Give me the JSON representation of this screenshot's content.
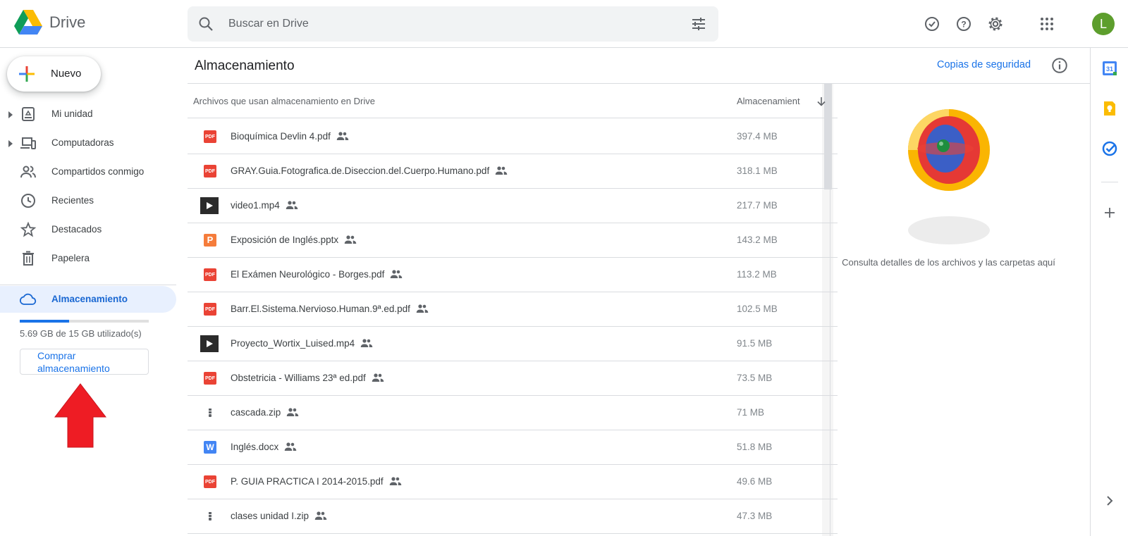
{
  "header": {
    "app_name": "Drive",
    "search_placeholder": "Buscar en Drive",
    "avatar_letter": "L",
    "icons": [
      "ready-offline-icon",
      "help-icon",
      "settings-icon",
      "apps-icon"
    ]
  },
  "sidebar": {
    "new_label": "Nuevo",
    "items": [
      {
        "label": "Mi unidad",
        "icon": "my-drive-icon"
      },
      {
        "label": "Computadoras",
        "icon": "computers-icon"
      },
      {
        "label": "Compartidos conmigo",
        "icon": "shared-icon"
      },
      {
        "label": "Recientes",
        "icon": "clock-icon"
      },
      {
        "label": "Destacados",
        "icon": "star-icon"
      },
      {
        "label": "Papelera",
        "icon": "trash-icon"
      }
    ],
    "storage": {
      "label": "Almacenamiento",
      "used_text": "5.69 GB de 15 GB utilizado(s)",
      "used_fraction": 0.38,
      "buy_label": "Comprar almacenamiento"
    }
  },
  "main": {
    "title": "Almacenamiento",
    "backup_link": "Copias de seguridad",
    "table": {
      "col_name": "Archivos que usan almacenamiento en Drive",
      "col_size": "Almacenamient",
      "rows": [
        {
          "name": "Bioquímica Devlin 4.pdf",
          "size": "397.4 MB",
          "type": "pdf"
        },
        {
          "name": "GRAY.Guia.Fotografica.de.Diseccion.del.Cuerpo.Humano.pdf",
          "size": "318.1 MB",
          "type": "pdf"
        },
        {
          "name": "video1.mp4",
          "size": "217.7 MB",
          "type": "video"
        },
        {
          "name": "Exposición de Inglés.pptx",
          "size": "143.2 MB",
          "type": "pptx"
        },
        {
          "name": "El Exámen Neurológico - Borges.pdf",
          "size": "113.2 MB",
          "type": "pdf"
        },
        {
          "name": "Barr.El.Sistema.Nervioso.Human.9ª.ed.pdf",
          "size": "102.5 MB",
          "type": "pdf"
        },
        {
          "name": "Proyecto_Wortix_Luised.mp4",
          "size": "91.5 MB",
          "type": "video"
        },
        {
          "name": "Obstetricia - Williams 23ª ed.pdf",
          "size": "73.5 MB",
          "type": "pdf"
        },
        {
          "name": "cascada.zip",
          "size": "71 MB",
          "type": "zip"
        },
        {
          "name": "Inglés.docx",
          "size": "51.8 MB",
          "type": "docx"
        },
        {
          "name": "P. GUIA PRACTICA I 2014-2015.pdf",
          "size": "49.6 MB",
          "type": "pdf"
        },
        {
          "name": "clases unidad I.zip",
          "size": "47.3 MB",
          "type": "zip"
        }
      ]
    },
    "details_text": "Consulta detalles de los archivos y las carpetas aquí"
  },
  "colors": {
    "accent": "#1a73e8",
    "active_bg": "#e8f0fe",
    "pdf": "#ea4335",
    "arrow": "#ee1c24"
  }
}
